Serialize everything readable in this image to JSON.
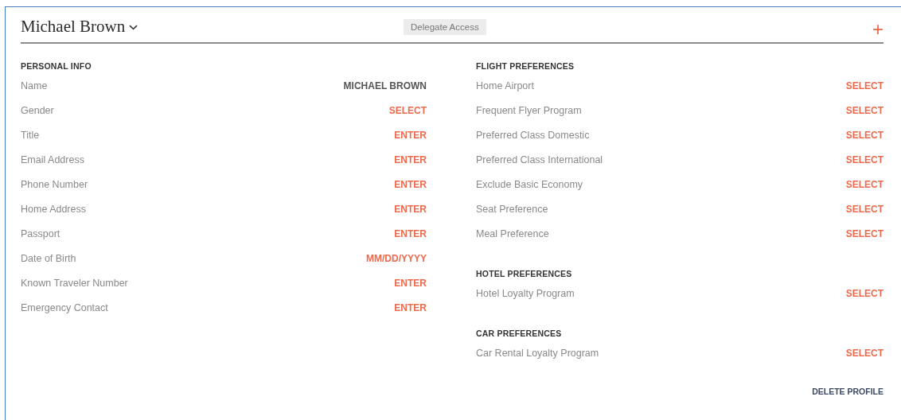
{
  "profile": {
    "name": "Michael Brown",
    "delegate_button": "Delegate Access",
    "add_icon": "+"
  },
  "personal_info": {
    "heading": "PERSONAL INFO",
    "rows": [
      {
        "label": "Name",
        "value": "MICHAEL BROWN",
        "kind": "value"
      },
      {
        "label": "Gender",
        "value": "SELECT",
        "kind": "prompt"
      },
      {
        "label": "Title",
        "value": "ENTER",
        "kind": "prompt"
      },
      {
        "label": "Email Address",
        "value": "ENTER",
        "kind": "prompt"
      },
      {
        "label": "Phone Number",
        "value": "ENTER",
        "kind": "prompt"
      },
      {
        "label": "Home Address",
        "value": "ENTER",
        "kind": "prompt"
      },
      {
        "label": "Passport",
        "value": "ENTER",
        "kind": "prompt"
      },
      {
        "label": "Date of Birth",
        "value": "MM/DD/YYYY",
        "kind": "prompt"
      },
      {
        "label": "Known Traveler Number",
        "value": "ENTER",
        "kind": "prompt"
      },
      {
        "label": "Emergency Contact",
        "value": "ENTER",
        "kind": "prompt"
      }
    ]
  },
  "preferences": [
    {
      "heading": "FLIGHT PREFERENCES",
      "rows": [
        {
          "label": "Home Airport",
          "value": "SELECT",
          "kind": "prompt"
        },
        {
          "label": "Frequent Flyer Program",
          "value": "SELECT",
          "kind": "prompt"
        },
        {
          "label": "Preferred Class Domestic",
          "value": "SELECT",
          "kind": "prompt"
        },
        {
          "label": "Preferred Class International",
          "value": "SELECT",
          "kind": "prompt"
        },
        {
          "label": "Exclude Basic Economy",
          "value": "SELECT",
          "kind": "prompt"
        },
        {
          "label": "Seat Preference",
          "value": "SELECT",
          "kind": "prompt"
        },
        {
          "label": "Meal Preference",
          "value": "SELECT",
          "kind": "prompt"
        }
      ]
    },
    {
      "heading": "HOTEL PREFERENCES",
      "rows": [
        {
          "label": "Hotel Loyalty Program",
          "value": "SELECT",
          "kind": "prompt"
        }
      ]
    },
    {
      "heading": "CAR PREFERENCES",
      "rows": [
        {
          "label": "Car Rental Loyalty Program",
          "value": "SELECT",
          "kind": "prompt"
        }
      ]
    }
  ],
  "delete_button": "DELETE PROFILE"
}
